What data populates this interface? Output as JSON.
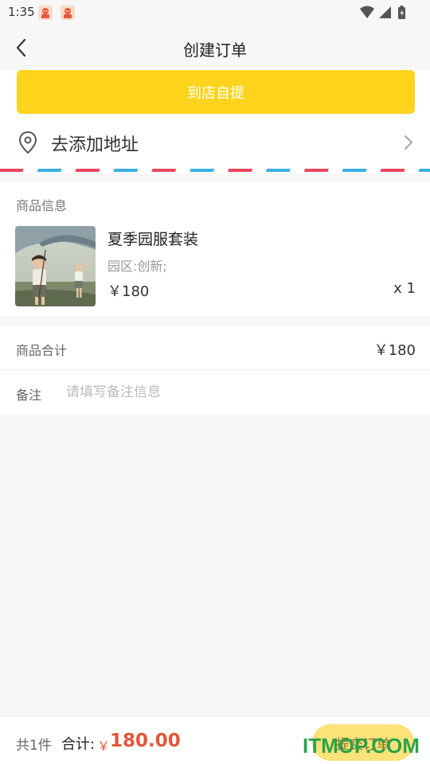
{
  "status_bar": {
    "time": "1:35",
    "icons": [
      "app-notification-icon",
      "app-notification-icon",
      "wifi-icon",
      "signal-icon",
      "battery-icon"
    ]
  },
  "header": {
    "title": "创建订单",
    "back_icon": "chevron-left-icon"
  },
  "delivery": {
    "pickup_label": "到店自提",
    "address_label": "去添加地址",
    "address_icon": "location-pin-icon",
    "chevron_icon": "chevron-right-icon",
    "accent_color": "#fdd31c"
  },
  "product_section": {
    "title": "商品信息",
    "items": [
      {
        "name": "夏季园服套装",
        "spec": "园区:创新;",
        "price": "￥180",
        "quantity": "x 1",
        "thumbnail_icon": "child-with-umbrella-photo"
      }
    ]
  },
  "summary": {
    "subtotal_label": "商品合计",
    "subtotal_value": "￥180",
    "remark_label": "备注",
    "remark_placeholder": "请填写备注信息",
    "remark_value": ""
  },
  "footer": {
    "count_text": "共1件",
    "total_label": "合计:",
    "currency_symbol": "￥",
    "total_amount": "180.00",
    "submit_label": "提交订单",
    "price_color": "#e2573a"
  },
  "watermark": "ITMOP.COM"
}
